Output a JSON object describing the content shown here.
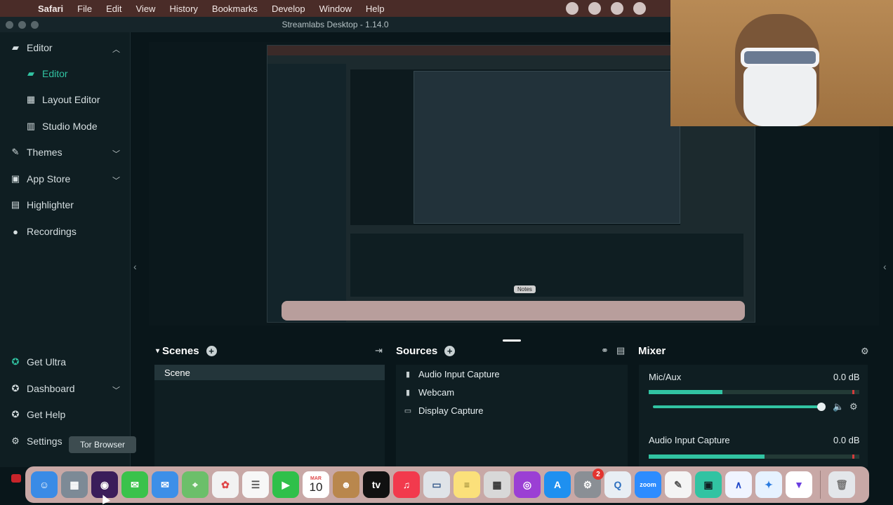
{
  "menubar": {
    "app": "Safari",
    "items": [
      "File",
      "Edit",
      "View",
      "History",
      "Bookmarks",
      "Develop",
      "Window",
      "Help"
    ]
  },
  "window": {
    "title": "Streamlabs Desktop - 1.14.0"
  },
  "sidebar": {
    "items": [
      {
        "label": "Editor",
        "icon": "editor-icon"
      },
      {
        "label": "Editor",
        "icon": "editor-icon"
      },
      {
        "label": "Layout Editor",
        "icon": "layout-grid-icon"
      },
      {
        "label": "Studio Mode",
        "icon": "studio-mode-icon"
      },
      {
        "label": "Themes",
        "icon": "themes-icon"
      },
      {
        "label": "App Store",
        "icon": "app-store-icon"
      },
      {
        "label": "Highlighter",
        "icon": "highlighter-icon"
      },
      {
        "label": "Recordings",
        "icon": "recordings-icon"
      }
    ],
    "bottom": [
      {
        "label": "Get Ultra",
        "icon": "ultra-icon"
      },
      {
        "label": "Dashboard",
        "icon": "dashboard-icon"
      },
      {
        "label": "Get Help",
        "icon": "help-icon"
      },
      {
        "label": "Settings",
        "icon": "settings-gear-icon"
      }
    ]
  },
  "preview": {
    "tooltip": "Notes"
  },
  "scenes": {
    "title": "Scenes",
    "items": [
      "Scene"
    ]
  },
  "sources": {
    "title": "Sources",
    "items": [
      "Audio Input Capture",
      "Webcam",
      "Display Capture"
    ]
  },
  "mixer": {
    "title": "Mixer",
    "channels": [
      {
        "name": "Mic/Aux",
        "db": "0.0 dB",
        "level": 0.35,
        "volume": 1.0
      },
      {
        "name": "Audio Input Capture",
        "db": "0.0 dB",
        "level": 0.55
      }
    ]
  },
  "dock": {
    "tooltip": "Tor Browser",
    "calendar": {
      "month": "MAR",
      "day": "10"
    },
    "zoom_label": "zoom",
    "badge": "2"
  },
  "colors": {
    "accent": "#31c3a2",
    "background": "#09161a",
    "panel": "#0f1e22"
  }
}
